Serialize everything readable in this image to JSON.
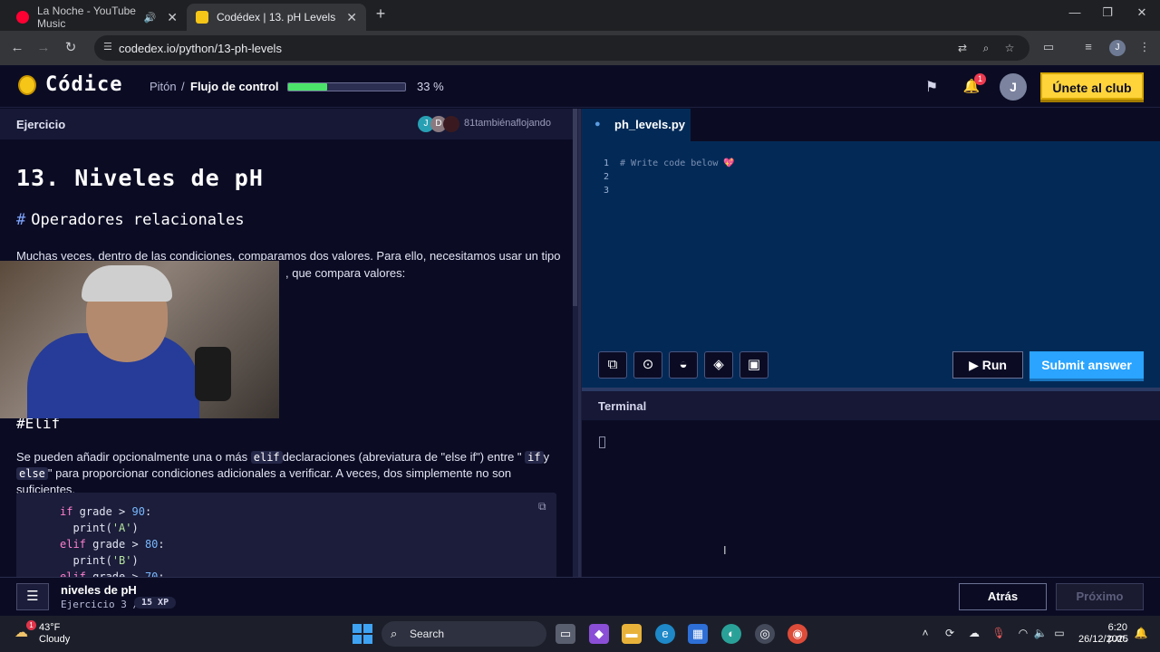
{
  "browser": {
    "tabs": [
      {
        "title": "La Noche - YouTube Music",
        "active": false
      },
      {
        "title": "Codédex | 13. pH Levels",
        "active": true
      }
    ],
    "url": "codedex.io/python/13-ph-levels",
    "profile_initial": "J"
  },
  "header": {
    "logo": "Códice",
    "breadcrumb_lang": "Pitón",
    "breadcrumb_sep": "/",
    "breadcrumb_chapter": "Flujo de control",
    "progress_fraction": 0.33,
    "progress_label": "33 %",
    "notifications_count": "1",
    "avatar_initial": "J",
    "club_button": "Únete al club"
  },
  "exercise_panel": {
    "label": "Ejercicio",
    "avatars": [
      "J",
      "D",
      ""
    ],
    "online_text": "81tambiénaflojando",
    "lesson_title": "13. Niveles de pH",
    "section1_hash": "#",
    "section1_title": "Operadores relacionales",
    "para1_line1": "Muchas veces, dentro de las condiciones, comparamos dos valores. Para ello, necesitamos usar un tipo",
    "para1_line2": ", que compara valores:",
    "section2_title": "#Elif",
    "para2_a": "Se pueden añadir opcionalmente una o más ",
    "para2_code1": "elif",
    "para2_b": "declaraciones (abreviatura de \"else if\") entre \" ",
    "para2_code2": "if",
    "para2_c": "y",
    "para2_code3": "else",
    "para2_d": "\" para proporcionar condiciones adicionales a verificar. A veces, dos simplemente no son suficientes.",
    "code_example": [
      {
        "kw": "if",
        "rest": " grade > ",
        "num": "90",
        "tail": ":"
      },
      {
        "indent": "  ",
        "fn": "print(",
        "str": "'A'",
        "end": ")"
      },
      {
        "kw": "elif",
        "rest": " grade > ",
        "num": "80",
        "tail": ":"
      },
      {
        "indent": "  ",
        "fn": "print(",
        "str": "'B'",
        "end": ")"
      },
      {
        "kw": "elif",
        "rest": " grade > ",
        "num": "70",
        "tail": ":"
      }
    ]
  },
  "editor": {
    "file_name": "ph_levels.py",
    "line_numbers": [
      "1",
      "2",
      "3"
    ],
    "line1_comment": "# Write code below 💖",
    "run_label": "Run",
    "submit_label": "Submit answer"
  },
  "terminal": {
    "label": "Terminal"
  },
  "bottom_bar": {
    "title": "niveles de pH",
    "progress": "Ejercicio 3 / 6",
    "xp": "15 XP",
    "back_label": "Atrás",
    "next_label": "Próximo"
  },
  "taskbar": {
    "weather_badge": "1",
    "temp": "43°F",
    "condition": "Cloudy",
    "search_label": "Search",
    "time": "6:20 p.m.",
    "date": "26/12/2025"
  }
}
